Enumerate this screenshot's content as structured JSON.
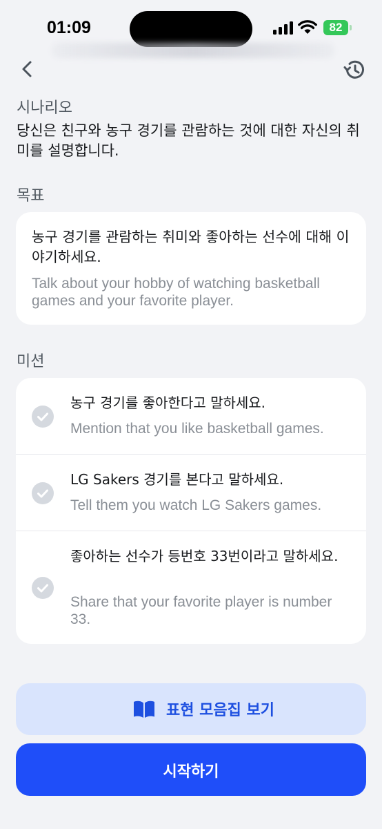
{
  "status_bar": {
    "time": "01:09",
    "battery": "82"
  },
  "header": {
    "back_icon": "chevron-left-icon",
    "history_icon": "history-icon"
  },
  "scenario": {
    "label": "시나리오",
    "text": "당신은 친구와 농구 경기를 관람하는 것에 대한 자신의 취미를 설명합니다."
  },
  "goal": {
    "label": "목표",
    "ko": "농구 경기를 관람하는 취미와 좋아하는 선수에 대해 이야기하세요.",
    "en": "Talk about your hobby of watching basketball games and your favorite player."
  },
  "missions": {
    "label": "미션",
    "items": [
      {
        "ko": "농구 경기를 좋아한다고 말하세요.",
        "en": "Mention that you like basketball games."
      },
      {
        "ko": "LG Sakers 경기를 본다고 말하세요.",
        "en": "Tell them you watch LG Sakers games."
      },
      {
        "ko": "좋아하는 선수가 등번호 33번이라고 말하세요.",
        "en": "Share that your favorite player is number 33."
      }
    ]
  },
  "actions": {
    "phrase_label": "표현 모음집 보기",
    "phrase_icon": "book-open-icon",
    "start_label": "시작하기"
  },
  "colors": {
    "background": "#f2f3f6",
    "primary": "#1f4ef9",
    "primary_light": "#d9e4fd",
    "check_inactive": "#d5d9df"
  }
}
